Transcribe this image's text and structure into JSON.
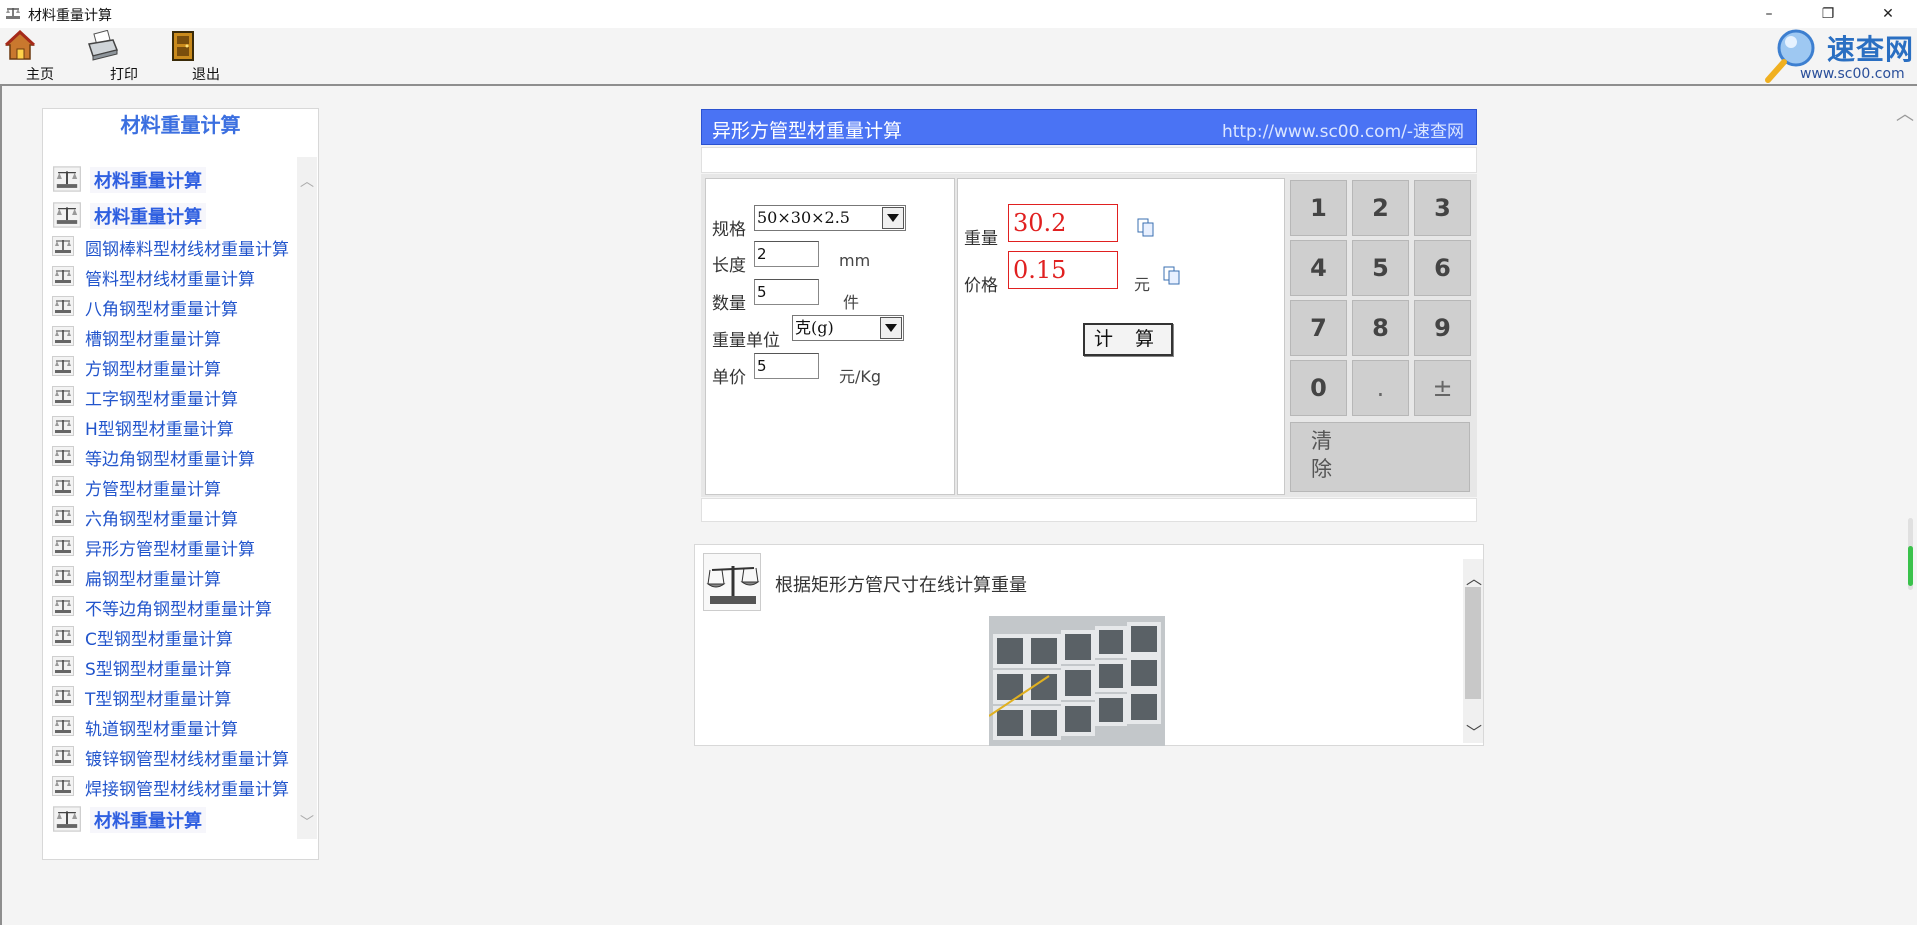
{
  "window": {
    "title": "材料重量计算",
    "minimize": "–",
    "restore": "❐",
    "close": "✕"
  },
  "toolbar": {
    "home": "主页",
    "print": "打印",
    "exit": "退出"
  },
  "logo": {
    "name": "速查网",
    "url": "www.sc00.com"
  },
  "nav": {
    "heading": "材料重量计算",
    "items": [
      {
        "label": "材料重量计算",
        "type": "head"
      },
      {
        "label": "材料重量计算",
        "type": "head"
      },
      {
        "label": "圆钢棒料型材线材重量计算"
      },
      {
        "label": "管料型材线材重量计算"
      },
      {
        "label": "八角钢型材重量计算"
      },
      {
        "label": "槽钢型材重量计算"
      },
      {
        "label": "方钢型材重量计算"
      },
      {
        "label": "工字钢型材重量计算"
      },
      {
        "label": "H型钢型材重量计算"
      },
      {
        "label": "等边角钢型材重量计算"
      },
      {
        "label": "方管型材重量计算"
      },
      {
        "label": "六角钢型材重量计算"
      },
      {
        "label": "异形方管型材重量计算"
      },
      {
        "label": "扁钢型材重量计算"
      },
      {
        "label": "不等边角钢型材重量计算"
      },
      {
        "label": "C型钢型材重量计算"
      },
      {
        "label": "S型钢型材重量计算"
      },
      {
        "label": "T型钢型材重量计算"
      },
      {
        "label": "轨道钢型材重量计算"
      },
      {
        "label": "镀锌钢管型材线材重量计算"
      },
      {
        "label": "焊接钢管型材线材重量计算"
      },
      {
        "label": "材料重量计算",
        "type": "head"
      }
    ]
  },
  "calc": {
    "title": "异形方管型材重量计算",
    "link": "http://www.sc00.com/-速查网",
    "spec_label": "规格",
    "spec_value": "50×30×2.5",
    "length_label": "长度",
    "length_value": "2",
    "length_unit": "mm",
    "count_label": "数量",
    "count_value": "5",
    "count_unit": "件",
    "weight_unit_label": "重量单位",
    "weight_unit_value": "克(g)",
    "price_label": "单价",
    "price_value": "5",
    "price_unit": "元/Kg",
    "weight_result_label": "重量",
    "weight_result": "30.2",
    "total_price_label": "价格",
    "total_price": "0.15",
    "total_price_unit": "元",
    "calc_button": "计 算",
    "keys": [
      "1",
      "2",
      "3",
      "4",
      "5",
      "6",
      "7",
      "8",
      "9",
      "0",
      ".",
      "±"
    ],
    "clear_key": "清除"
  },
  "info": {
    "description": "根据矩形方管尺寸在线计算重量"
  },
  "colors": {
    "header_blue": "#4a73f4",
    "nav_link": "#2255cc",
    "result_red": "#e02020"
  }
}
